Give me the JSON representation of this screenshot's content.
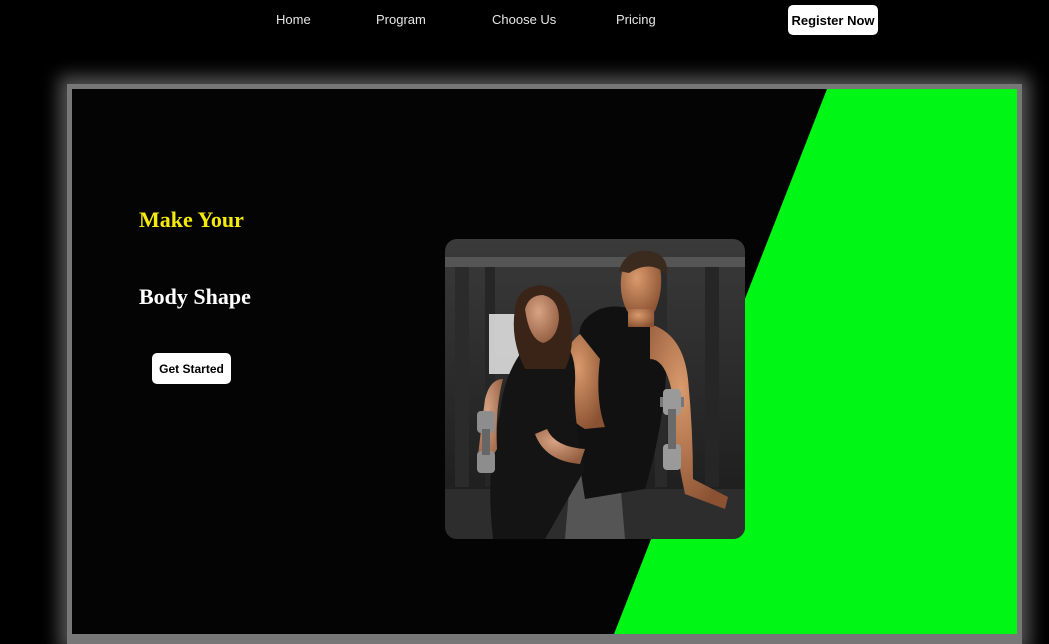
{
  "nav": {
    "links": [
      "Home",
      "Program",
      "Choose Us",
      "Pricing"
    ],
    "register_label": "Register Now"
  },
  "hero": {
    "headline_line1": "Make Your",
    "headline_line2": "Body Shape",
    "cta_label": "Get Started",
    "image_alt": "two-athletes-photo"
  },
  "colors": {
    "background": "#000000",
    "accent_green": "#00f715",
    "headline_yellow": "#f4ea0c",
    "button_bg": "#ffffff"
  }
}
